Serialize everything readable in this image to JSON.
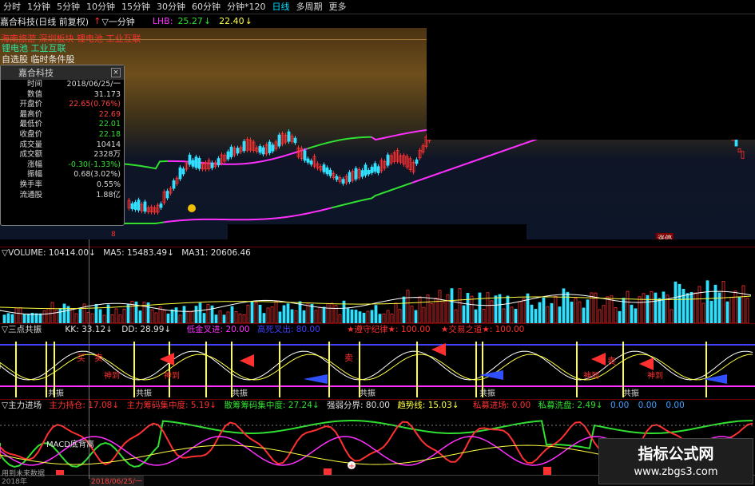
{
  "periods": [
    "分时",
    "1分钟",
    "5分钟",
    "10分钟",
    "15分钟",
    "30分钟",
    "60分钟",
    "分钟*120",
    "日线",
    "多周期",
    "更多"
  ],
  "active_period": "日线",
  "title": {
    "stock": "嘉合科技(日线 前复权)",
    "one_min": "▽一分钟",
    "lhb": "LHB:",
    "v1": "25.27",
    "v2": "22.40"
  },
  "tags": {
    "row1": "海南旅游 深圳板块 锂电池 工业互联",
    "row2": "锂电池 工业互联",
    "row3": "自选股 临时条件股"
  },
  "info": {
    "name": "嘉合科技",
    "close": "×",
    "rows": [
      {
        "label": "时间",
        "value": "2018/06/25/一",
        "color": "#d8d8d8"
      },
      {
        "label": "数值",
        "value": "31.173",
        "color": "#d8d8d8"
      },
      {
        "label": "开盘价",
        "value": "22.65(0.76%)",
        "color": "#ff4040"
      },
      {
        "label": "最高价",
        "value": "22.69",
        "color": "#ff4040"
      },
      {
        "label": "最低价",
        "value": "22.01",
        "color": "#30e030"
      },
      {
        "label": "收盘价",
        "value": "22.18",
        "color": "#30e030"
      },
      {
        "label": "成交量",
        "value": "10414",
        "color": "#d8d8d8"
      },
      {
        "label": "成交额",
        "value": "2328万",
        "color": "#d8d8d8"
      },
      {
        "label": "涨幅",
        "value": "-0.30(-1.33%)",
        "color": "#30e030"
      },
      {
        "label": "振幅",
        "value": "0.68(3.02%)",
        "color": "#d8d8d8"
      },
      {
        "label": "换手率",
        "value": "0.55%",
        "color": "#d8d8d8"
      },
      {
        "label": "流通股",
        "value": "1.88亿",
        "color": "#d8d8d8"
      }
    ]
  },
  "price_markers": {
    "low_label": "8",
    "high_label": "涨停"
  },
  "volume": {
    "label": "▽VOLUME: 10414.00",
    "ma5": "MA5: 15483.49",
    "ma31": "MA31: 20606.46"
  },
  "sandian": {
    "label": "▽三点共振",
    "kk": "KK: 33.12",
    "dd": "DD: 28.99",
    "gold": "低金叉进: 20.00",
    "dead": "高死叉出: 80.00",
    "discipline": "★遵守纪律★: 100.00",
    "way": "★交易之道★: 100.00",
    "buy": "买",
    "sell": "卖",
    "gongzhen": "共振",
    "shen": "神到"
  },
  "zhuli": {
    "label": "▽主力进场",
    "hold": "主力持仓: 17.08",
    "conc": "主力筹码集中度: 5.19",
    "retail": "散筹筹码集中度: 27.24",
    "strength": "强弱分界: 80.00",
    "trend": "趋势线: 15.03",
    "private_in": "私募进场: 0.00",
    "private_out": "私募洗盘: 2.49",
    "z1": "0.00",
    "z2": "0.00",
    "z3": "0.00",
    "macd": "MACD底背离",
    "date": "2018/06/25/一",
    "foot_left": "用到未来数据",
    "year": "2018年"
  },
  "watermark": {
    "title": "指标公式网",
    "url": "www.zbgs3.com"
  },
  "colors": {
    "up": "#ff3030",
    "down": "#30e0ff",
    "accent": "#00e0ff",
    "magenta": "#ff30ff",
    "green": "#30e030",
    "yellow": "#ffff40"
  }
}
